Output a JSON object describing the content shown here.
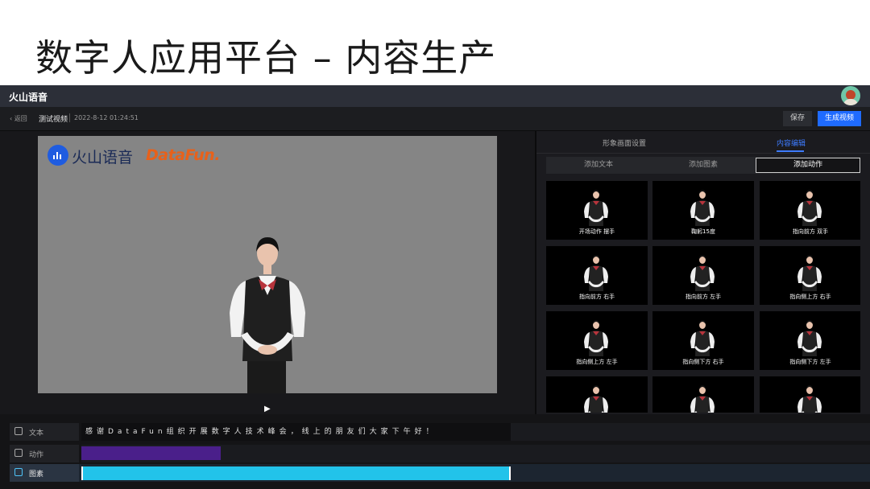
{
  "slide": {
    "title": "数字人应用平台 – 内容生产"
  },
  "app": {
    "brand": "火山语音"
  },
  "subbar": {
    "back_label": "‹ 返回",
    "project_name": "测试视频",
    "timestamp": "2022-8-12 01:24:51",
    "save_label": "保存",
    "generate_label": "生成视频"
  },
  "preview": {
    "logo_huoshan": "火山语音",
    "logo_datafun": "DataFun.",
    "play_icon": "▶"
  },
  "panel": {
    "tabs": [
      {
        "label": "形象画面设置",
        "active": false
      },
      {
        "label": "内容编辑",
        "active": true
      }
    ],
    "segments": [
      {
        "label": "添加文本",
        "active": false
      },
      {
        "label": "添加图素",
        "active": false
      },
      {
        "label": "添加动作",
        "active": true
      }
    ],
    "actions": [
      "开场动作 摆手",
      "鞠躬15度",
      "指向前方 双手",
      "指向前方 右手",
      "指向前方 左手",
      "指向侧上方 右手",
      "指向侧上方 左手",
      "指向侧下方 右手",
      "指向侧下方 左手",
      "",
      "",
      ""
    ]
  },
  "timeline": {
    "tracks": [
      {
        "label": "文本",
        "icon": "text-icon"
      },
      {
        "label": "动作",
        "icon": "play-box-icon"
      },
      {
        "label": "图素",
        "icon": "image-icon"
      }
    ],
    "text_content": "感谢DataFun组织开展数字人技术峰会，线上的朋友们大家下午好！"
  },
  "colors": {
    "accent": "#1f6bff",
    "action_clip": "#4a1f8a",
    "image_clip": "#22c3ea"
  }
}
